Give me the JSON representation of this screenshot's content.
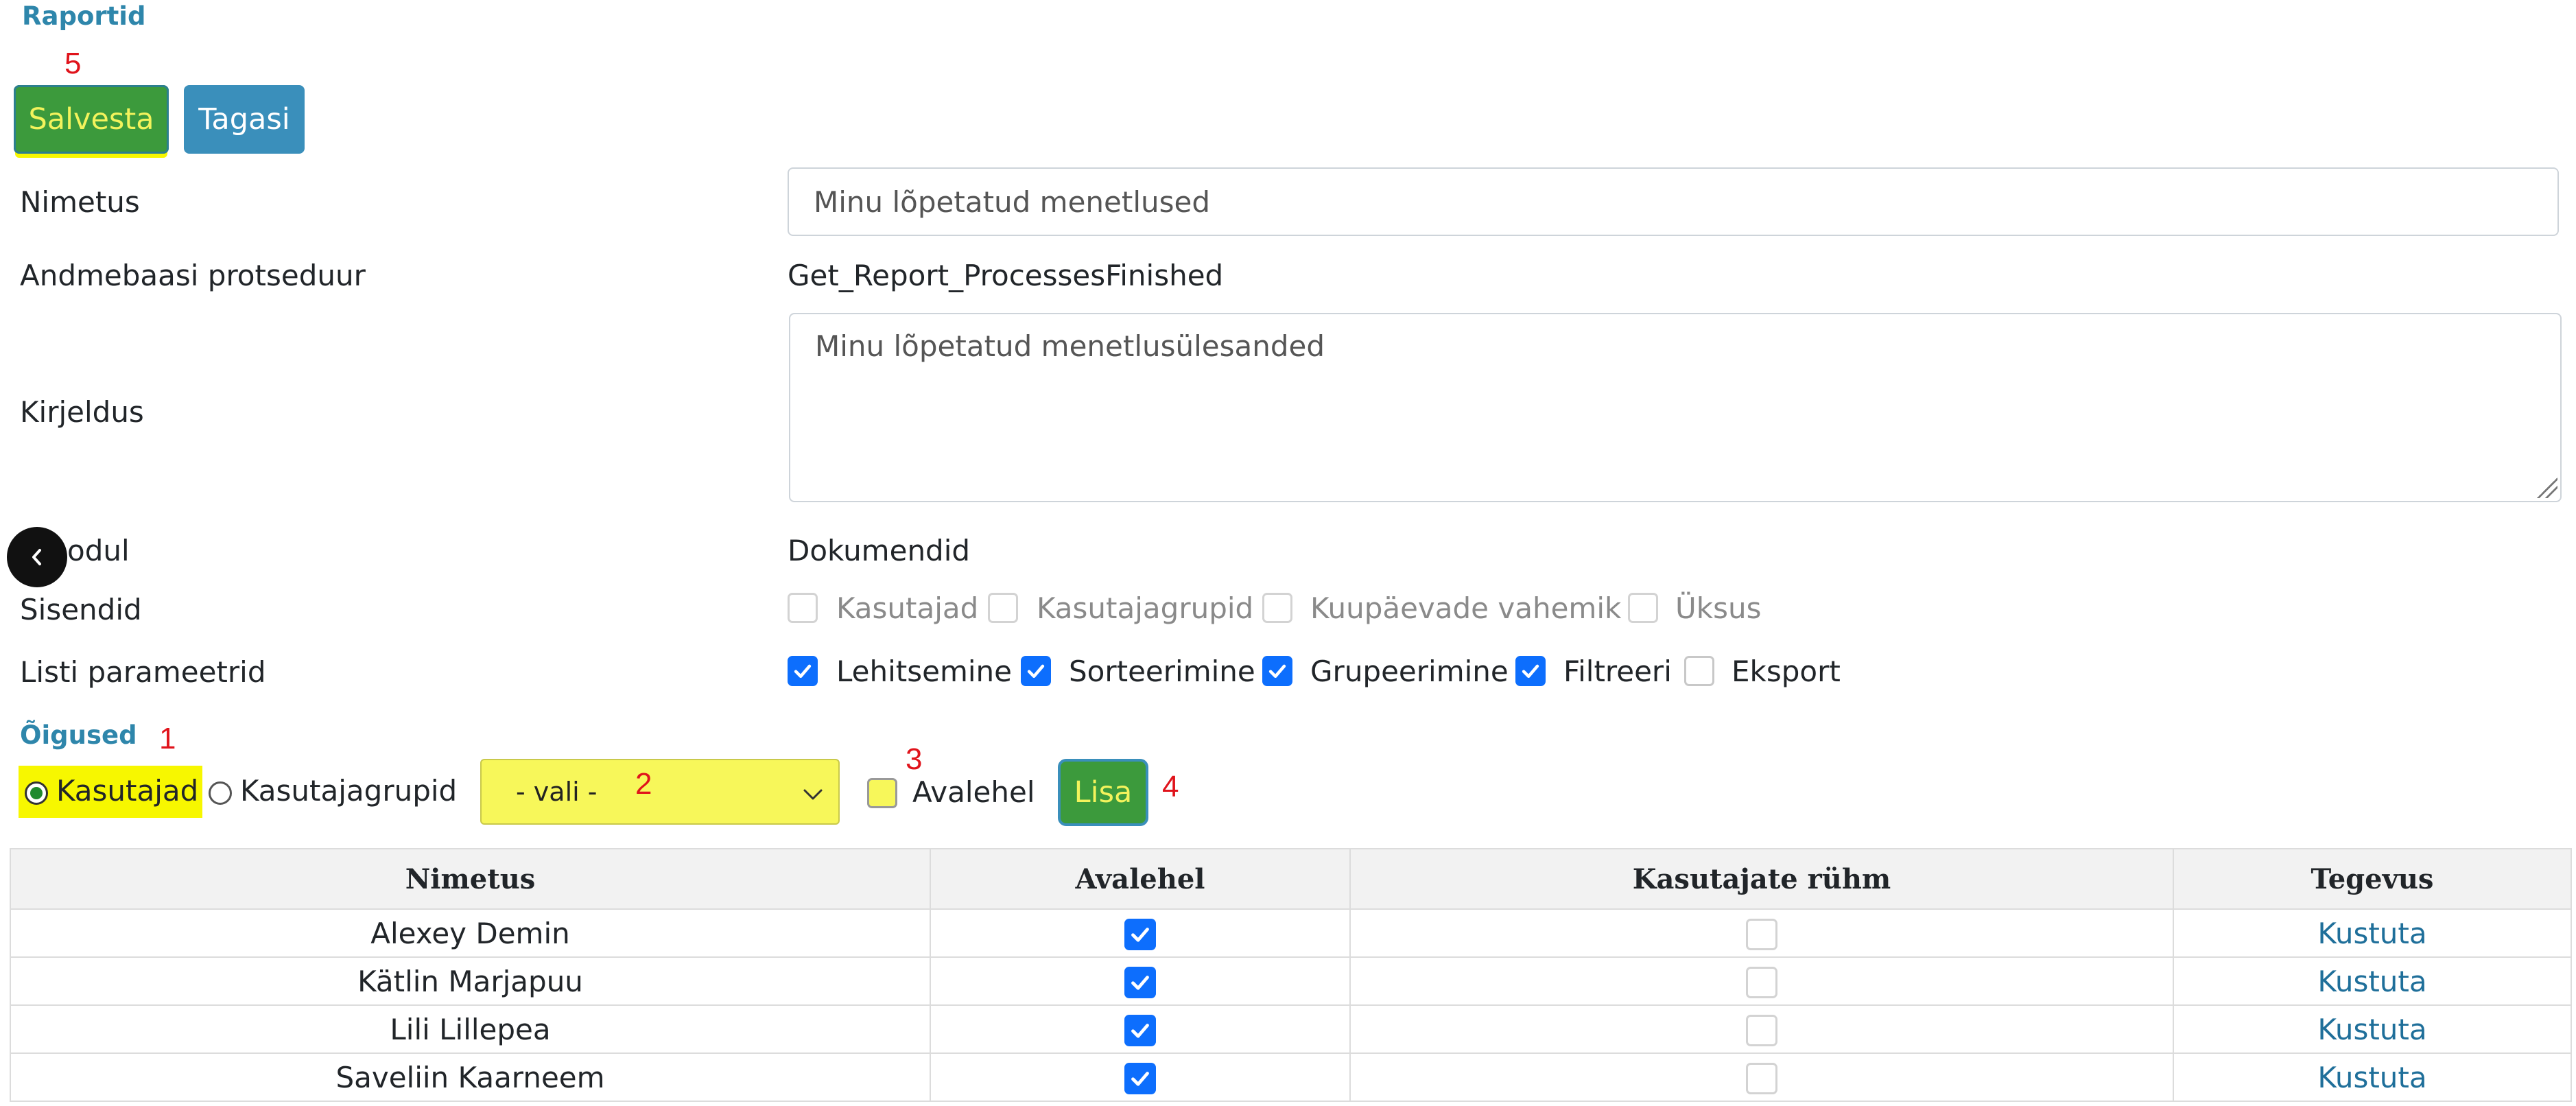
{
  "header": {
    "breadcrumb": "Raportid"
  },
  "annotations": [
    "1",
    "2",
    "3",
    "4",
    "5"
  ],
  "toolbar": {
    "save_label": "Salvesta",
    "back_label": "Tagasi"
  },
  "form": {
    "name_label": "Nimetus",
    "name_value": "Minu lõpetatud menetlused",
    "procedure_label": "Andmebaasi protseduur",
    "procedure_value": "Get_Report_ProcessesFinished",
    "description_label": "Kirjeldus",
    "description_value": "Minu lõpetatud menetlusülesanded",
    "module_label": "Moodul",
    "module_label_visible": "odul",
    "module_value": "Dokumendid",
    "inputs_label": "Sisendid",
    "inputs_options": [
      {
        "label": "Kasutajad",
        "checked": false
      },
      {
        "label": "Kasutajagrupid",
        "checked": false
      },
      {
        "label": "Kuupäevade vahemik",
        "checked": false
      },
      {
        "label": "Üksus",
        "checked": false
      }
    ],
    "list_params_label": "Listi parameetrid",
    "list_params_options": [
      {
        "label": "Lehitsemine",
        "checked": true
      },
      {
        "label": "Sorteerimine",
        "checked": true
      },
      {
        "label": "Grupeerimine",
        "checked": true
      },
      {
        "label": "Filtreeri",
        "checked": true
      },
      {
        "label": "Eksport",
        "checked": false
      }
    ]
  },
  "rights": {
    "title": "Õigused",
    "radio_users": "Kasutajad",
    "radio_groups": "Kasutajagrupid",
    "radio_selected": "Kasutajad",
    "select_value": "- vali -",
    "frontpage_label": "Avalehel",
    "frontpage_checked": false,
    "add_label": "Lisa"
  },
  "table": {
    "columns": [
      "Nimetus",
      "Avalehel",
      "Kasutajate rühm",
      "Tegevus"
    ],
    "rows": [
      {
        "name": "Alexey Demin",
        "frontpage": true,
        "group": false,
        "action": "Kustuta"
      },
      {
        "name": "Kätlin Marjapuu",
        "frontpage": true,
        "group": false,
        "action": "Kustuta"
      },
      {
        "name": "Lili Lillepea",
        "frontpage": true,
        "group": false,
        "action": "Kustuta"
      },
      {
        "name": "Saveliin Kaarneem",
        "frontpage": true,
        "group": false,
        "action": "Kustuta"
      }
    ]
  },
  "colors": {
    "accent_blue": "#3a8fbb",
    "save_green": "#3c9a3c",
    "highlight_yellow": "#f7f700",
    "checkbox_blue": "#0d6efd",
    "annotation_red": "#e0131b"
  },
  "icons": {
    "nav": "chevron-left-icon",
    "select": "chevron-down-icon",
    "check": "check-icon"
  }
}
